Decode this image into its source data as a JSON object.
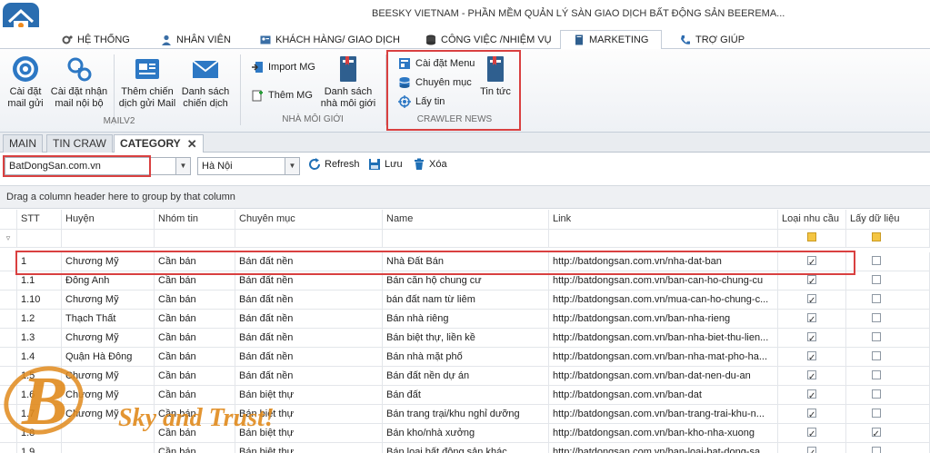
{
  "app": {
    "title": "BEESKY VIETNAM - PHẦN MỀM QUẢN LÝ SÀN GIAO DỊCH BẤT ĐỘNG SẢN BEEREMA..."
  },
  "ribbon_tabs": [
    {
      "label": "HỆ THỐNG",
      "icon": "gears-icon"
    },
    {
      "label": "NHÂN VIÊN",
      "icon": "user-icon"
    },
    {
      "label": "KHÁCH HÀNG/ GIAO DỊCH",
      "icon": "contact-card-icon"
    },
    {
      "label": "CÔNG VIỆC /NHIỆM VỤ",
      "icon": "database-icon"
    },
    {
      "label": "MARKETING",
      "icon": "book-icon",
      "active": true
    },
    {
      "label": "TRỢ GIÚP",
      "icon": "phone-icon"
    }
  ],
  "ribbon": {
    "mail_group": {
      "label": "MAILV2",
      "buttons": [
        "Cài đặt\nmail gửi",
        "Cài đặt nhận\nmail nội bộ",
        "Thêm chiến\ndịch gửi Mail",
        "Danh sách\nchiến dịch"
      ]
    },
    "broker_group": {
      "label": "NHÀ MÔI GIỚI",
      "small_buttons": [
        "Import MG",
        "Thêm MG"
      ],
      "large_button": "Danh sách\nnhà môi giới"
    },
    "crawler_group": {
      "label": "CRAWLER NEWS",
      "small_buttons": [
        "Cài đặt Menu",
        "Chuyên mục",
        "Lấy tin"
      ],
      "large_button": "Tin tức"
    }
  },
  "doc_tabs": [
    {
      "label": "MAIN"
    },
    {
      "label": "TIN CRAW"
    },
    {
      "label": "CATEGORY",
      "active": true,
      "closable": true
    }
  ],
  "toolbar": {
    "site_combo": "BatDongSan.com.vn",
    "city_combo": "Hà Nội",
    "refresh": "Refresh",
    "save": "Lưu",
    "delete": "Xóa"
  },
  "group_panel": "Drag a column header here to group by that column",
  "grid": {
    "columns": [
      "STT",
      "Huyện",
      "Nhóm tin",
      "Chuyên mục",
      "Name",
      "Link",
      "Loại nhu cầu",
      "Lấy dữ liệu"
    ],
    "rows": [
      {
        "stt": "1",
        "huyen": "Chương Mỹ",
        "nhom": "Cần bán",
        "chuyen": "Bán đất nền",
        "name": "Nhà Đất Bán",
        "link": "http://batdongsan.com.vn/nha-dat-ban",
        "loai": true,
        "lay": false
      },
      {
        "stt": "1.1",
        "huyen": "Đông Anh",
        "nhom": "Cần bán",
        "chuyen": "Bán đất nền",
        "name": "Bán căn hộ chung cư",
        "link": "http://batdongsan.com.vn/ban-can-ho-chung-cu",
        "loai": true,
        "lay": false
      },
      {
        "stt": "1.10",
        "huyen": "Chương Mỹ",
        "nhom": "Cần bán",
        "chuyen": "Bán đất nền",
        "name": "bán đất nam từ liêm",
        "link": "http://batdongsan.com.vn/mua-can-ho-chung-c...",
        "loai": true,
        "lay": false
      },
      {
        "stt": "1.2",
        "huyen": "Thạch Thất",
        "nhom": "Cần bán",
        "chuyen": "Bán đất nền",
        "name": "Bán nhà riêng",
        "link": "http://batdongsan.com.vn/ban-nha-rieng",
        "loai": true,
        "lay": false
      },
      {
        "stt": "1.3",
        "huyen": "Chương Mỹ",
        "nhom": "Cần bán",
        "chuyen": "Bán đất nền",
        "name": "Bán biệt thự, liền kề",
        "link": "http://batdongsan.com.vn/ban-nha-biet-thu-lien...",
        "loai": true,
        "lay": false
      },
      {
        "stt": "1.4",
        "huyen": "Quận Hà Đông",
        "nhom": "Cần bán",
        "chuyen": "Bán đất nền",
        "name": "Bán nhà mặt phố",
        "link": "http://batdongsan.com.vn/ban-nha-mat-pho-ha...",
        "loai": true,
        "lay": false
      },
      {
        "stt": "1.5",
        "huyen": "Chương Mỹ",
        "nhom": "Cần bán",
        "chuyen": "Bán đất nền",
        "name": "Bán đất nền dự án",
        "link": "http://batdongsan.com.vn/ban-dat-nen-du-an",
        "loai": true,
        "lay": false
      },
      {
        "stt": "1.6",
        "huyen": "Chương Mỹ",
        "nhom": "Cần bán",
        "chuyen": "Bán biệt thự",
        "name": "Bán đất",
        "link": "http://batdongsan.com.vn/ban-dat",
        "loai": true,
        "lay": false
      },
      {
        "stt": "1.7",
        "huyen": "Chương Mỹ",
        "nhom": "Cần bán",
        "chuyen": "Bán biệt thự",
        "name": "Bán trang trại/khu nghỉ dưỡng",
        "link": "http://batdongsan.com.vn/ban-trang-trai-khu-n...",
        "loai": true,
        "lay": false
      },
      {
        "stt": "1.8",
        "huyen": "",
        "nhom": "Cần bán",
        "chuyen": "Bán biệt thự",
        "name": "Bán kho/nhà xưởng",
        "link": "http://batdongsan.com.vn/ban-kho-nha-xuong",
        "loai": true,
        "lay": true
      },
      {
        "stt": "1.9",
        "huyen": "",
        "nhom": "Cần bán",
        "chuyen": "Bán biệt thự",
        "name": "Bán loại bất động sản khác",
        "link": "http://batdongsan.com.vn/ban-loai-bat-dong-sa...",
        "loai": true,
        "lay": false
      }
    ]
  },
  "watermark": {
    "letter": "B",
    "text": "Sky and Trust!"
  },
  "colors": {
    "accent": "#1f6fb5",
    "highlight": "#d94040",
    "logo_orange": "#f08a1c",
    "watermark": "#e08a1c"
  }
}
